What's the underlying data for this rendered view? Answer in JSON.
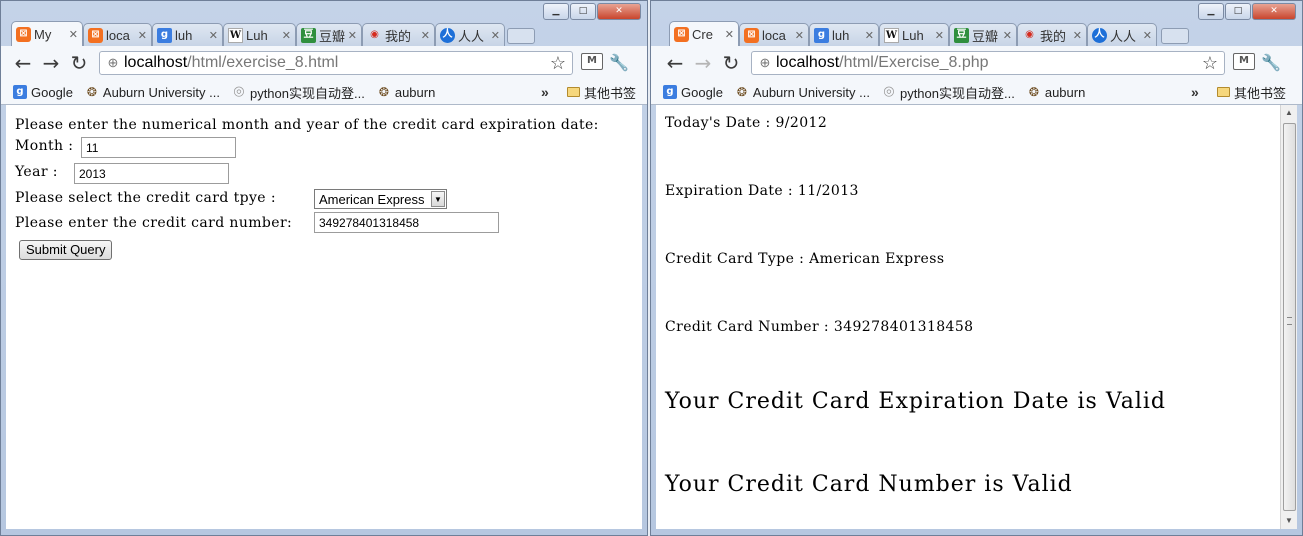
{
  "left_window": {
    "tabs": [
      {
        "title": "My",
        "favicon": "xampp-icon"
      },
      {
        "title": "loca",
        "favicon": "xampp-icon"
      },
      {
        "title": "luh",
        "favicon": "google-icon"
      },
      {
        "title": "Luh",
        "favicon": "wikipedia-icon"
      },
      {
        "title": "豆瓣",
        "favicon": "douban-icon"
      },
      {
        "title": "我的",
        "favicon": "weibo-icon"
      },
      {
        "title": "人人",
        "favicon": "renren-icon"
      }
    ],
    "url_host": "localhost",
    "url_path": "/html/exercise_8.html",
    "form": {
      "intro": "Please enter the numerical month and year of the credit card expiration date:",
      "month_label": "Month :",
      "month_value": "11",
      "year_label": "Year :",
      "year_value": "2013",
      "type_label": "Please select the credit card tpye :",
      "type_value": "American Express",
      "number_label": "Please enter the credit card number:",
      "number_value": "349278401318458",
      "submit_label": "Submit Query"
    }
  },
  "right_window": {
    "tabs": [
      {
        "title": "Cre",
        "favicon": "xampp-icon"
      },
      {
        "title": "loca",
        "favicon": "xampp-icon"
      },
      {
        "title": "luh",
        "favicon": "google-icon"
      },
      {
        "title": "Luh",
        "favicon": "wikipedia-icon"
      },
      {
        "title": "豆瓣",
        "favicon": "douban-icon"
      },
      {
        "title": "我的",
        "favicon": "weibo-icon"
      },
      {
        "title": "人人",
        "favicon": "renren-icon"
      }
    ],
    "url_host": "localhost",
    "url_path": "/html/Exercise_8.php",
    "result": {
      "today": "Today's Date : 9/2012",
      "expiration": "Expiration Date : 11/2013",
      "card_type": "Credit Card Type : American Express",
      "card_number": "Credit Card Number : 349278401318458",
      "expiration_valid": "Your Credit Card Expiration Date is Valid",
      "number_valid": "Your Credit Card Number is Valid"
    }
  },
  "bookmarks": {
    "items": [
      "Google",
      "Auburn University ...",
      "python实现自动登...",
      "auburn"
    ],
    "more": "»",
    "folder": "其他书签"
  },
  "colors": {
    "frame": "#b6c7e0",
    "toolbar": "#f4f7fb",
    "xampp": "#f37021"
  }
}
